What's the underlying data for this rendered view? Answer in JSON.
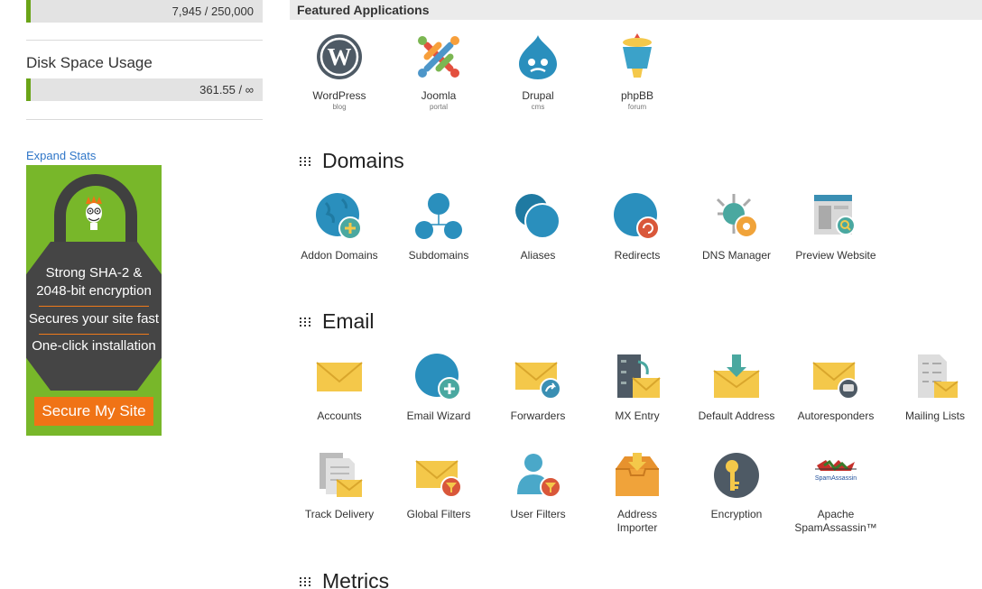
{
  "sidebar": {
    "top_bar_value": "7,945 / 250,000",
    "disk": {
      "title": "Disk Space Usage",
      "value": "361.55 / ∞"
    },
    "expand_stats": "Expand Stats"
  },
  "ad": {
    "line1": "Strong SHA-2 &",
    "line2": "2048-bit encryption",
    "line3": "Secures your site fast",
    "line4": "One-click installation",
    "button": "Secure My Site"
  },
  "featured": {
    "title": "Featured Applications",
    "apps": [
      {
        "label": "WordPress",
        "sub": "blog",
        "icon": "wordpress-icon"
      },
      {
        "label": "Joomla",
        "sub": "portal",
        "icon": "joomla-icon"
      },
      {
        "label": "Drupal",
        "sub": "cms",
        "icon": "drupal-icon"
      },
      {
        "label": "phpBB",
        "sub": "forum",
        "icon": "phpbb-icon"
      }
    ]
  },
  "domains": {
    "title": "Domains",
    "items": [
      {
        "label": "Addon Domains",
        "icon": "globe-plus-icon"
      },
      {
        "label": "Subdomains",
        "icon": "globe-network-icon"
      },
      {
        "label": "Aliases",
        "icon": "double-globe-icon"
      },
      {
        "label": "Redirects",
        "icon": "globe-redirect-icon"
      },
      {
        "label": "DNS Manager",
        "icon": "dns-gear-icon"
      },
      {
        "label": "Preview Website",
        "icon": "browser-search-icon"
      }
    ]
  },
  "email": {
    "title": "Email",
    "row1": [
      {
        "label": "Accounts",
        "icon": "envelope-icon"
      },
      {
        "label": "Email Wizard",
        "icon": "globe-plus-icon"
      },
      {
        "label": "Forwarders",
        "icon": "envelope-forward-icon"
      },
      {
        "label": "MX Entry",
        "icon": "server-envelope-icon"
      },
      {
        "label": "Default Address",
        "icon": "envelope-download-icon"
      },
      {
        "label": "Autoresponders",
        "icon": "envelope-chat-icon"
      },
      {
        "label": "Mailing Lists",
        "icon": "list-envelope-icon"
      }
    ],
    "row2": [
      {
        "label": "Track Delivery",
        "icon": "documents-envelope-icon"
      },
      {
        "label": "Global Filters",
        "icon": "envelope-filter-icon"
      },
      {
        "label": "User Filters",
        "icon": "user-filter-icon"
      },
      {
        "label": "Address",
        "label2": "Importer",
        "icon": "box-import-icon"
      },
      {
        "label": "Encryption",
        "icon": "key-icon"
      },
      {
        "label": "Apache",
        "label2": "SpamAssassin™",
        "icon": "spamassassin-icon",
        "logo_text": "SpamAssassin"
      }
    ]
  },
  "metrics": {
    "title": "Metrics"
  },
  "colors": {
    "globe": "#2a8fbd",
    "envelope": "#f4c84a",
    "accent_green": "#6aa418",
    "ad_orange": "#f07316"
  }
}
